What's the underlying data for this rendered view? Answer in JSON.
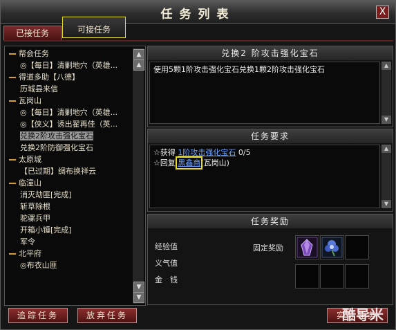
{
  "window": {
    "title": "任务列表",
    "close_label": "X"
  },
  "tabs": [
    {
      "label": "已接任务",
      "active": false
    },
    {
      "label": "可接任务",
      "active": true
    }
  ],
  "quest_tree": [
    {
      "kind": "group",
      "label": "帮会任务"
    },
    {
      "kind": "child",
      "label": "◎【每日】清剿地穴（英雄..."
    },
    {
      "kind": "group",
      "label": "得道多助【八德】"
    },
    {
      "kind": "child",
      "label": "历城县来信"
    },
    {
      "kind": "group",
      "label": "瓦岗山"
    },
    {
      "kind": "child",
      "label": "◎【每日】清剿地穴（英雄..."
    },
    {
      "kind": "child",
      "label": "◎【侠义】诱出翟再佳（英..."
    },
    {
      "kind": "child",
      "label": "兑换2阶攻击强化宝石",
      "selected": true
    },
    {
      "kind": "child",
      "label": "兑换2阶防御强化宝石"
    },
    {
      "kind": "group",
      "label": "太原城"
    },
    {
      "kind": "child",
      "label": "【已过期】绸布换祥云"
    },
    {
      "kind": "group",
      "label": "临潼山"
    },
    {
      "kind": "child",
      "label": "消灭劫匪[完成]"
    },
    {
      "kind": "child",
      "label": "斩草除根"
    },
    {
      "kind": "child",
      "label": "驼骡兵甲"
    },
    {
      "kind": "child",
      "label": "开箱小锤[完成]"
    },
    {
      "kind": "child",
      "label": "军令"
    },
    {
      "kind": "group",
      "label": "北平府"
    },
    {
      "kind": "child",
      "label": "◎布衣山匪"
    }
  ],
  "detail": {
    "quest_title": "兑换2 阶攻击强化宝石",
    "description": "使用5颗1阶攻击强化宝石兑换1颗2阶攻击强化宝石",
    "requirements_header": "任务要求",
    "req_obtain_prefix": "☆获得",
    "req_obtain_item": "1阶攻击强化宝石",
    "req_obtain_count": "0/5",
    "req_return_prefix": "☆回复",
    "req_return_npc": "黑鑫商",
    "req_return_location": "(瓦岗山)",
    "rewards_header": "任务奖励",
    "reward_exp_label": "经验值",
    "reward_righteous_label": "义气值",
    "reward_money_label": "金　钱",
    "fixed_reward_label": "固定奖励",
    "reward_icons": [
      "purple-gem-icon",
      "blue-flower-gem-icon"
    ]
  },
  "buttons": {
    "track": "追踪任务",
    "abandon": "放弃任务",
    "accept": "实际任务"
  },
  "watermark": "酷导米",
  "colors": {
    "link": "#6aa0ff",
    "highlight": "#e6dc2a",
    "button_red": "#8a2d2d",
    "group_dash": "#d8a030"
  }
}
